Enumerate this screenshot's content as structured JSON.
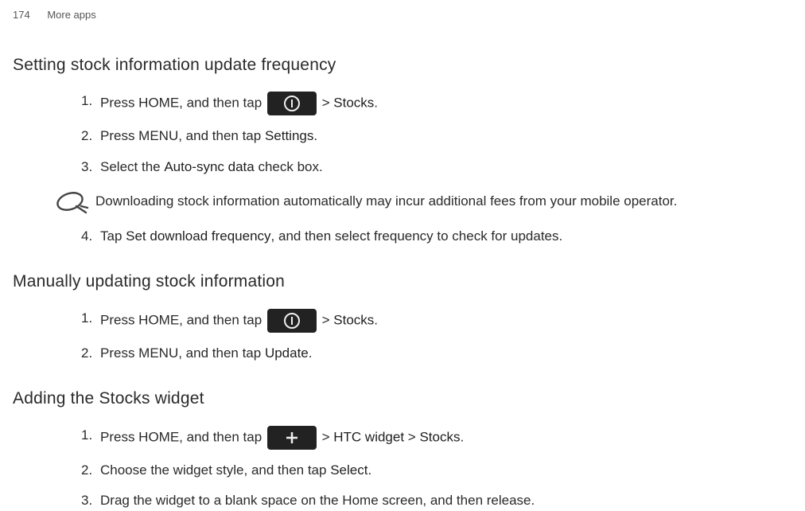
{
  "page_header": {
    "number": "174",
    "section": "More apps"
  },
  "s1": {
    "title": "Setting stock information update frequency",
    "n1": "1.",
    "i1a": "Press HOME, and then tap ",
    "i1b": " > ",
    "i1c": "Stocks",
    "i1d": ".",
    "n2": "2.",
    "i2a": "Press MENU, and then tap ",
    "i2b": "Settings",
    "i2c": ".",
    "n3": "3.",
    "i3a": "Select the ",
    "i3b": "Auto-sync data",
    "i3c": " check box.",
    "note": "Downloading stock information automatically may incur additional fees from your mobile operator.",
    "n4": "4.",
    "i4a": "Tap ",
    "i4b": "Set download frequency",
    "i4c": ", and then select frequency to check for updates."
  },
  "s2": {
    "title": "Manually updating stock information",
    "n1": "1.",
    "i1a": "Press HOME, and then tap ",
    "i1b": " > ",
    "i1c": "Stocks",
    "i1d": ".",
    "n2": "2.",
    "i2a": "Press MENU, and then tap ",
    "i2b": "Update",
    "i2c": "."
  },
  "s3": {
    "title": "Adding the Stocks widget",
    "n1": "1.",
    "i1a": "Press HOME, and then tap ",
    "i1b": " > ",
    "i1c": "HTC widget",
    "i1d": " > ",
    "i1e": "Stocks",
    "i1f": ".",
    "n2": "2.",
    "i2a": "Choose the widget style, and then tap ",
    "i2b": "Select",
    "i2c": ".",
    "n3": "3.",
    "i3": "Drag the widget to a blank space on the Home screen, and then release."
  }
}
